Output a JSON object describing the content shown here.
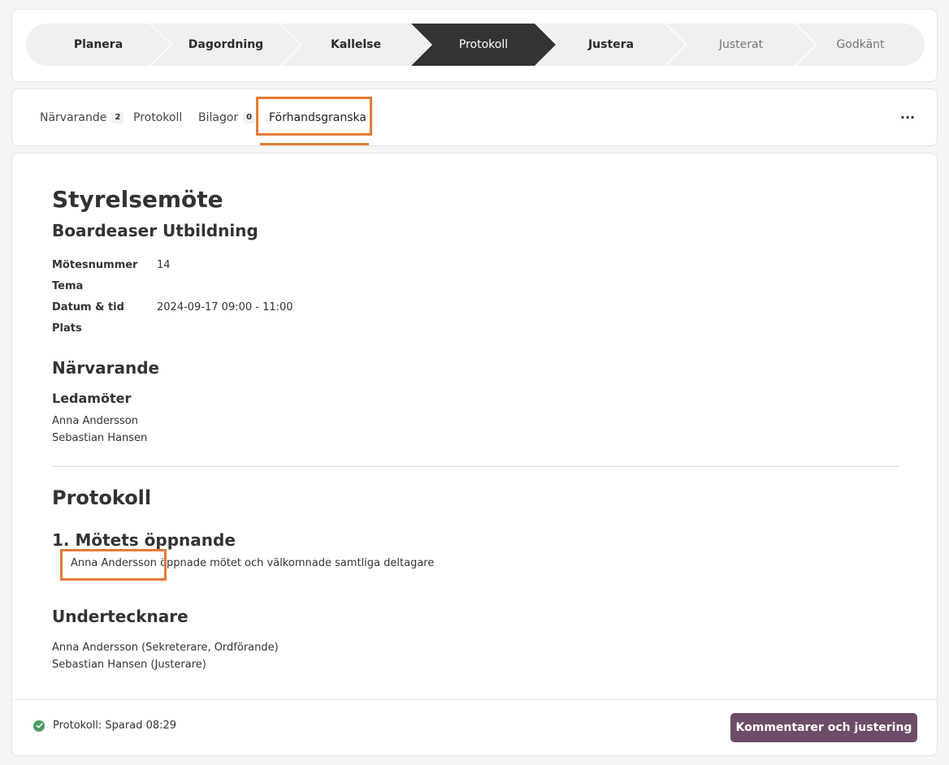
{
  "workflow": {
    "steps": [
      {
        "label": "Planera",
        "state": "done"
      },
      {
        "label": "Dagordning",
        "state": "done"
      },
      {
        "label": "Kallelse",
        "state": "done"
      },
      {
        "label": "Protokoll",
        "state": "active"
      },
      {
        "label": "Justera",
        "state": "done"
      },
      {
        "label": "Justerat",
        "state": "pending"
      },
      {
        "label": "Godkänt",
        "state": "pending"
      }
    ],
    "colors": {
      "step_bg": "#f0f0f0",
      "active_bg": "#333333"
    }
  },
  "tabs": {
    "items": [
      {
        "label": "Närvarande",
        "badge": "2"
      },
      {
        "label": "Protokoll"
      },
      {
        "label": "Bilagor",
        "badge": "0"
      },
      {
        "label": "Förhandsgranska",
        "selected": true
      }
    ],
    "more_icon": "ellipsis-icon",
    "more_label": "···"
  },
  "document": {
    "title": "Styrelsemöte",
    "organization": "Boardeaser Utbildning",
    "meta": [
      {
        "label": "Mötesnummer",
        "value": "14"
      },
      {
        "label": "Tema",
        "value": ""
      },
      {
        "label": "Datum & tid",
        "value": "2024-09-17 09:00 - 11:00"
      },
      {
        "label": "Plats",
        "value": ""
      }
    ],
    "attendance": {
      "heading": "Närvarande",
      "subheading": "Ledamöter",
      "members": [
        "Anna Andersson",
        "Sebastian Hansen"
      ]
    },
    "protocol": {
      "heading": "Protokoll",
      "item_title": "1. Mötets öppnande",
      "item_name": "Anna Andersson",
      "item_rest": " öppnade mötet och välkomnade samtliga deltagare"
    },
    "signatories": {
      "heading": "Undertecknare",
      "list": [
        "Anna Andersson (Sekreterare, Ordförande)",
        "Sebastian Hansen (Justerare)"
      ]
    }
  },
  "footer": {
    "status_icon": "check-circle-icon",
    "status": "Protokoll: Sparad 08:29",
    "button_label": "Kommentarer och justering",
    "button_color": "#6d4c67"
  },
  "highlight_color": "#e47b37"
}
